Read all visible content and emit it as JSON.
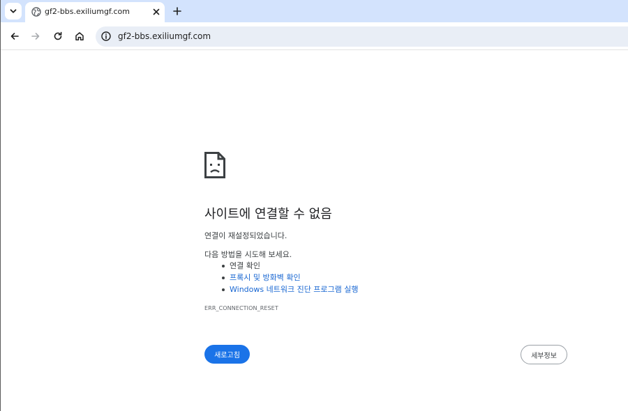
{
  "tab": {
    "title": "gf2-bbs.exiliumgf.com",
    "favicon": "globe-icon"
  },
  "toolbar": {
    "url": "gf2-bbs.exiliumgf.com"
  },
  "error": {
    "title": "사이트에 연결할 수 없음",
    "subtitle": "연결이 재설정되었습니다.",
    "try_label": "다음 방법을 시도해 보세요.",
    "suggestions": [
      {
        "label": "연결 확인",
        "is_link": false
      },
      {
        "label": "프록시 및 방화벽 확인",
        "is_link": true
      },
      {
        "label": "Windows 네트워크 진단 프로그램 실행",
        "is_link": true
      }
    ],
    "code": "ERR_CONNECTION_RESET",
    "reload_label": "새로고침",
    "details_label": "세부정보"
  },
  "colors": {
    "tabstrip": "#d3e3fd",
    "omnibox": "#e9eef6",
    "accent": "#1a73e8",
    "link": "#1967d2"
  }
}
